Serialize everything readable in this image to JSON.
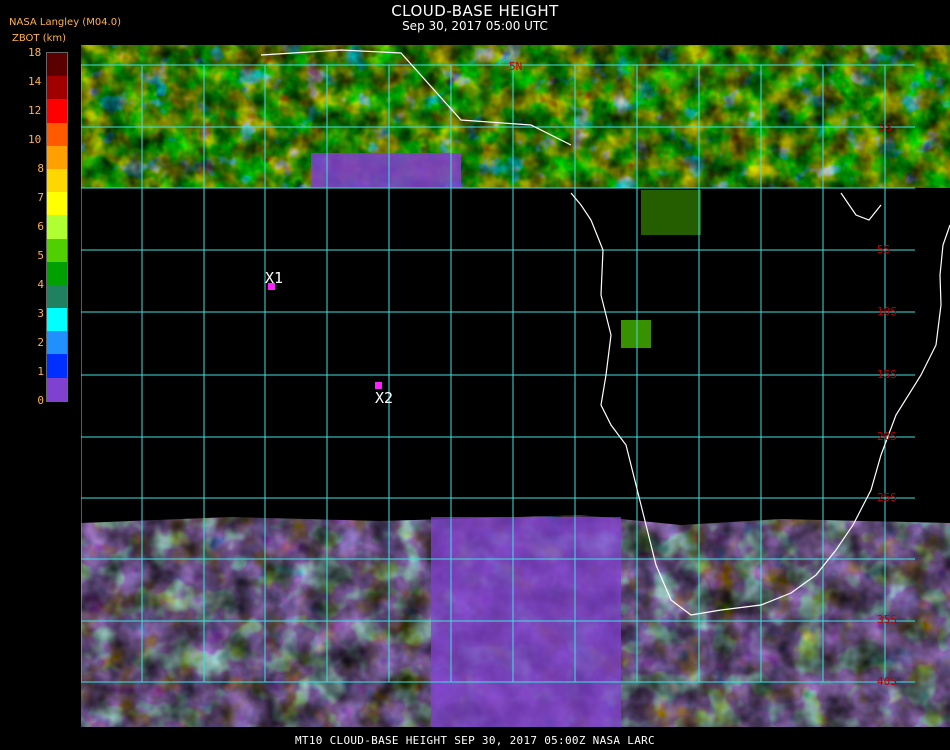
{
  "header": {
    "title": "CLOUD-BASE HEIGHT",
    "subtitle": "Sep 30, 2017 05:00 UTC",
    "source": "NASA Langley (M04.0)",
    "units": "ZBOT (km)"
  },
  "legend": {
    "ticks": [
      "18",
      "14",
      "12",
      "10",
      "8",
      "7",
      "6",
      "5",
      "4",
      "3",
      "2",
      "1",
      "0"
    ],
    "colors": [
      "#5a0000",
      "#a00000",
      "#ff0000",
      "#ff5a00",
      "#ffa000",
      "#ffd700",
      "#ffff00",
      "#b0ff30",
      "#50d000",
      "#00a000",
      "#208060",
      "#00ffff",
      "#2090ff",
      "#0030ff",
      "#8040d0"
    ]
  },
  "map": {
    "lat_labels": [
      "5S",
      "10S",
      "15S",
      "20S",
      "25S",
      "35S",
      "40S"
    ],
    "top_labels": [
      "5S",
      "5N"
    ],
    "markers": [
      {
        "label": "X1"
      },
      {
        "label": "X2"
      }
    ],
    "grid_color": "#40e0e0",
    "coast_color": "#ffffff",
    "label_color": "#c00000",
    "marker_color": "#ff20ff"
  },
  "footer": "MT10  CLOUD-BASE HEIGHT   SEP 30, 2017 05:00Z   NASA LARC"
}
